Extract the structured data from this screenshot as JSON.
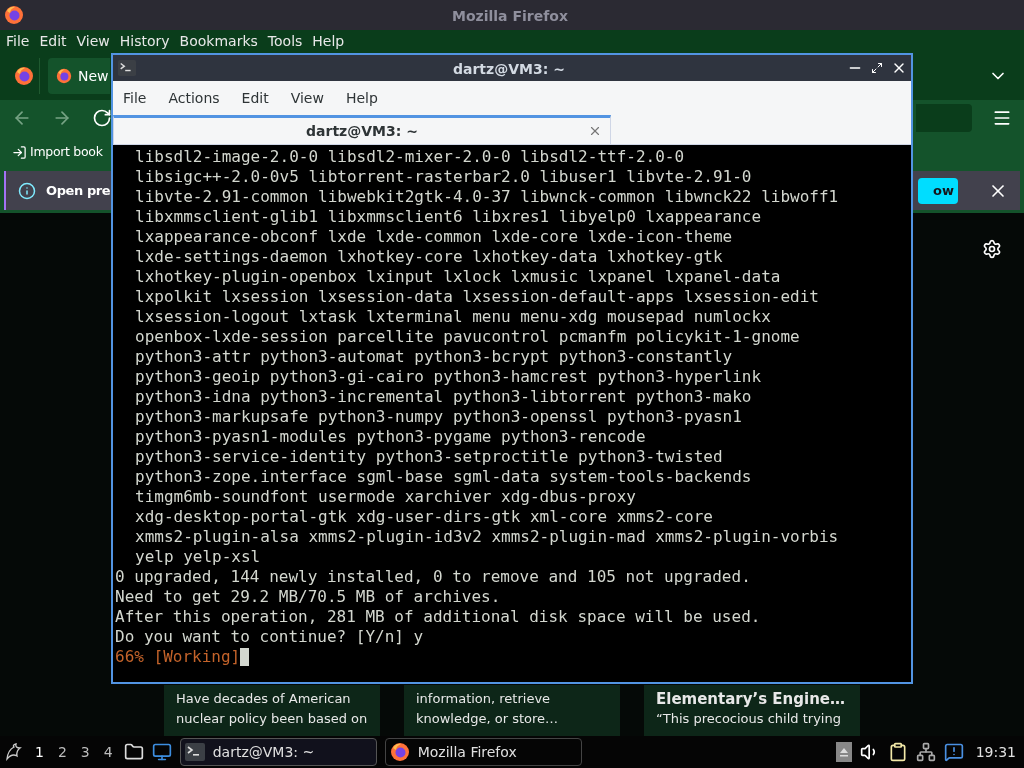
{
  "browser": {
    "title": "Mozilla Firefox",
    "menu": [
      "File",
      "Edit",
      "View",
      "History",
      "Bookmarks",
      "Tools",
      "Help"
    ],
    "tab": {
      "label": "New"
    },
    "bookmarks": [
      {
        "label": "Import book"
      }
    ],
    "notice": {
      "text": "Open pre",
      "button": "ow"
    },
    "cards": [
      {
        "lines": [
          "Have decades of American",
          "nuclear policy been based on"
        ]
      },
      {
        "lines": [
          "information, retrieve",
          "knowledge, or store…"
        ]
      },
      {
        "title": "Elementary’s Engine…",
        "lines": [
          "“This precocious child trying"
        ]
      }
    ]
  },
  "terminal": {
    "title": "dartz@VM3: ~",
    "menu": [
      "File",
      "Actions",
      "Edit",
      "View",
      "Help"
    ],
    "tab": {
      "label": "dartz@VM3: ~",
      "selected": true
    },
    "lines": [
      {
        "kind": "package",
        "text": "libsdl2-image-2.0-0 libsdl2-mixer-2.0-0 libsdl2-ttf-2.0-0"
      },
      {
        "kind": "package",
        "text": "libsigc++-2.0-0v5 libtorrent-rasterbar2.0 libuser1 libvte-2.91-0"
      },
      {
        "kind": "package",
        "text": "libvte-2.91-common libwebkit2gtk-4.0-37 libwnck-common libwnck22 libwoff1"
      },
      {
        "kind": "package",
        "text": "libxmmsclient-glib1 libxmmsclient6 libxres1 libyelp0 lxappearance"
      },
      {
        "kind": "package",
        "text": "lxappearance-obconf lxde lxde-common lxde-core lxde-icon-theme"
      },
      {
        "kind": "package",
        "text": "lxde-settings-daemon lxhotkey-core lxhotkey-data lxhotkey-gtk"
      },
      {
        "kind": "package",
        "text": "lxhotkey-plugin-openbox lxinput lxlock lxmusic lxpanel lxpanel-data"
      },
      {
        "kind": "package",
        "text": "lxpolkit lxsession lxsession-data lxsession-default-apps lxsession-edit"
      },
      {
        "kind": "package",
        "text": "lxsession-logout lxtask lxterminal menu menu-xdg mousepad numlockx"
      },
      {
        "kind": "package",
        "text": "openbox-lxde-session parcellite pavucontrol pcmanfm policykit-1-gnome"
      },
      {
        "kind": "package",
        "text": "python3-attr python3-automat python3-bcrypt python3-constantly"
      },
      {
        "kind": "package",
        "text": "python3-geoip python3-gi-cairo python3-hamcrest python3-hyperlink"
      },
      {
        "kind": "package",
        "text": "python3-idna python3-incremental python3-libtorrent python3-mako"
      },
      {
        "kind": "package",
        "text": "python3-markupsafe python3-numpy python3-openssl python3-pyasn1"
      },
      {
        "kind": "package",
        "text": "python3-pyasn1-modules python3-pygame python3-rencode"
      },
      {
        "kind": "package",
        "text": "python3-service-identity python3-setproctitle python3-twisted"
      },
      {
        "kind": "package",
        "text": "python3-zope.interface sgml-base sgml-data system-tools-backends"
      },
      {
        "kind": "package",
        "text": "timgm6mb-soundfont usermode xarchiver xdg-dbus-proxy"
      },
      {
        "kind": "package",
        "text": "xdg-desktop-portal-gtk xdg-user-dirs-gtk xml-core xmms2-core"
      },
      {
        "kind": "package",
        "text": "xmms2-plugin-alsa xmms2-plugin-id3v2 xmms2-plugin-mad xmms2-plugin-vorbis"
      },
      {
        "kind": "package",
        "text": "yelp yelp-xsl"
      },
      {
        "kind": "plain",
        "text": "0 upgraded, 144 newly installed, 0 to remove and 105 not upgraded."
      },
      {
        "kind": "plain",
        "text": "Need to get 29.2 MB/70.5 MB of archives."
      },
      {
        "kind": "plain",
        "text": "After this operation, 281 MB of additional disk space will be used."
      },
      {
        "kind": "plain",
        "text": "Do you want to continue? [Y/n] y"
      },
      {
        "kind": "progress",
        "text": "66% [Working]"
      }
    ]
  },
  "taskbar": {
    "desktops": [
      {
        "label": "1",
        "selected": true
      },
      {
        "label": "2",
        "selected": false
      },
      {
        "label": "3",
        "selected": false
      },
      {
        "label": "4",
        "selected": false
      }
    ],
    "tasks": [
      {
        "label": "dartz@VM3: ~",
        "kind": "terminal",
        "selected": true
      },
      {
        "label": "Mozilla Firefox",
        "kind": "firefox",
        "selected": false
      }
    ],
    "clock": "19:31"
  }
}
